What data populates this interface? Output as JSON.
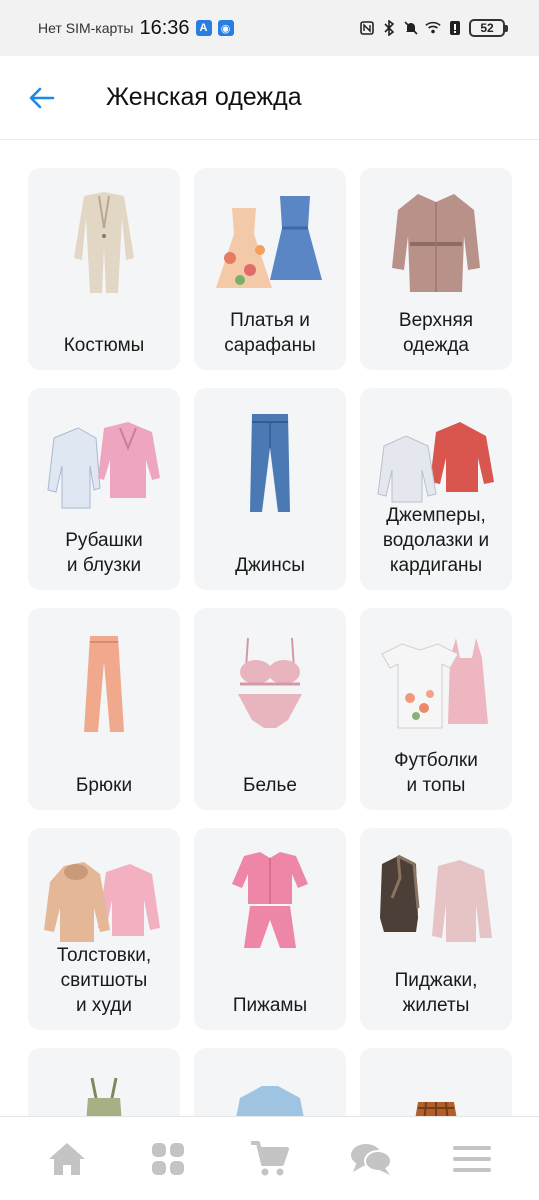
{
  "status_bar": {
    "carrier": "Нет SIM-карты",
    "time": "16:36",
    "battery": "52"
  },
  "header": {
    "title": "Женская одежда",
    "back_icon": "arrow-left-icon"
  },
  "colors": {
    "accent": "#1e88e5",
    "card_bg": "#f4f5f7",
    "nav_icon": "#c4c4c4"
  },
  "categories": [
    {
      "label": "Костюмы",
      "icon": "suit-image"
    },
    {
      "label": "Платья и\nсарафаны",
      "icon": "dresses-image"
    },
    {
      "label": "Верхняя\nодежда",
      "icon": "coat-image"
    },
    {
      "label": "Рубашки\nи блузки",
      "icon": "shirts-image"
    },
    {
      "label": "Джинсы",
      "icon": "jeans-image"
    },
    {
      "label": "Джемперы,\nводолазки и\nкардиганы",
      "icon": "sweaters-image"
    },
    {
      "label": "Брюки",
      "icon": "trousers-image"
    },
    {
      "label": "Белье",
      "icon": "lingerie-image"
    },
    {
      "label": "Футболки\nи топы",
      "icon": "tshirts-image"
    },
    {
      "label": "Толстовки,\nсвитшоты\nи худи",
      "icon": "hoodies-image"
    },
    {
      "label": "Пижамы",
      "icon": "pajamas-image"
    },
    {
      "label": "Пиджаки,\nжилеты",
      "icon": "blazers-image"
    },
    {
      "label": "",
      "icon": "top-image"
    },
    {
      "label": "",
      "icon": "blouse-image"
    },
    {
      "label": "",
      "icon": "skirt-image"
    }
  ],
  "bottom_nav": [
    {
      "icon": "home-icon"
    },
    {
      "icon": "catalog-icon"
    },
    {
      "icon": "cart-icon"
    },
    {
      "icon": "chat-icon"
    },
    {
      "icon": "menu-icon"
    }
  ]
}
